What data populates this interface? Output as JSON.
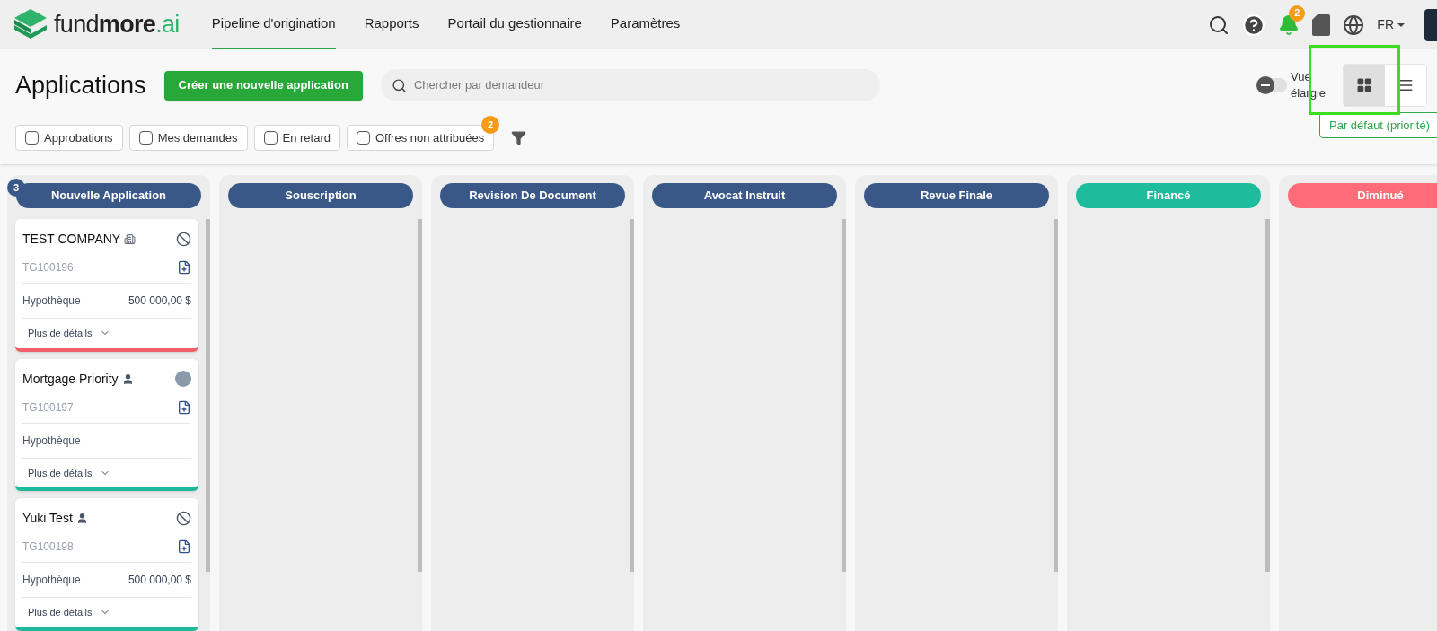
{
  "brand": {
    "name_light": "fund",
    "name_bold": "more",
    "name_suffix": ".ai"
  },
  "nav": [
    {
      "label": "Pipeline d'origination",
      "selected": true
    },
    {
      "label": "Rapports",
      "selected": false
    },
    {
      "label": "Portail du gestionnaire",
      "selected": false
    },
    {
      "label": "Paramètres",
      "selected": false
    }
  ],
  "header_tools": {
    "notification_count": "2",
    "language": "FR"
  },
  "page_title": "Applications",
  "create_button": "Créer une nouvelle application",
  "search": {
    "placeholder": "Chercher par demandeur"
  },
  "expanded_view": {
    "label": "Vue élargie",
    "on": false
  },
  "view_modes": [
    {
      "kind": "board",
      "selected": true
    },
    {
      "kind": "list",
      "selected": false
    }
  ],
  "sort": "Par défaut (priorité)",
  "filters": [
    {
      "label": "Approbations",
      "checked": false
    },
    {
      "label": "Mes demandes",
      "checked": false
    },
    {
      "label": "En retard",
      "checked": false
    },
    {
      "label": "Offres non attribuées",
      "checked": false,
      "badge": "2"
    }
  ],
  "columns": [
    {
      "title": "Nouvelle Application",
      "color": "#3a5887",
      "count": "3",
      "cards": [
        {
          "name": "TEST COMPANY",
          "company": true,
          "owner_assigned": false,
          "id": "TG100196",
          "product": "Hypothèque",
          "amount": "500 000,00 $",
          "more": "Plus de détails",
          "color": "#f0606a"
        },
        {
          "name": "Mortgage Priority",
          "company": false,
          "owner_assigned": true,
          "id": "TG100197",
          "product": "Hypothèque",
          "more": "Plus de détails",
          "color": "#1cb99a"
        },
        {
          "name": "Yuki Test",
          "company": false,
          "owner_assigned": false,
          "id": "TG100198",
          "product": "Hypothèque",
          "amount": "500 000,00 $",
          "more": "Plus de détails",
          "color": "#1cb99a"
        }
      ]
    },
    {
      "title": "Souscription",
      "color": "#3a5887"
    },
    {
      "title": "Revision De Document",
      "color": "#3a5887"
    },
    {
      "title": "Avocat Instruit",
      "color": "#3a5887"
    },
    {
      "title": "Revue Finale",
      "color": "#3a5887"
    },
    {
      "title": "Financé",
      "color": "#1cbc9c"
    },
    {
      "title": "Diminué",
      "color": "#ff6b78"
    }
  ]
}
